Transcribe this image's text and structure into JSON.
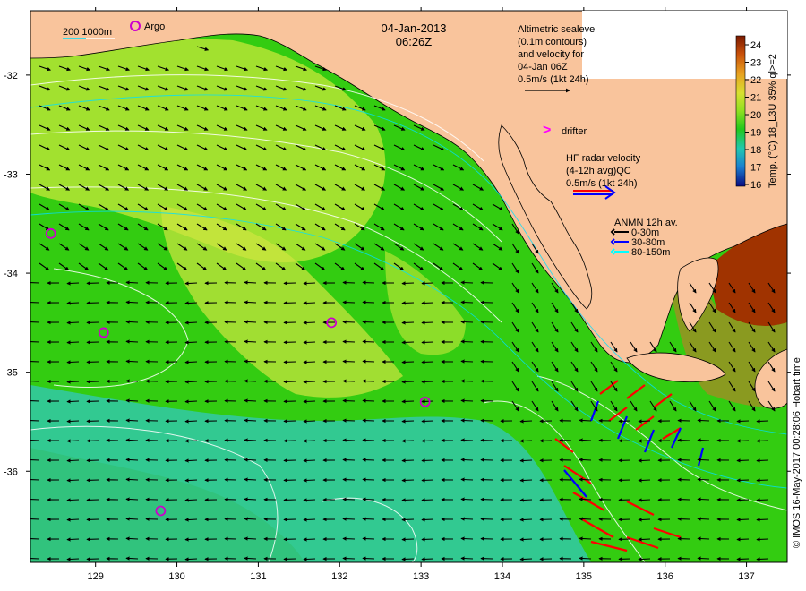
{
  "map": {
    "date": "04-Jan-2013",
    "time": "06:26Z",
    "lon_ticks": [
      "129",
      "130",
      "131",
      "132",
      "133",
      "134",
      "135",
      "136",
      "137"
    ],
    "lat_ticks": [
      "-32",
      "-33",
      "-34",
      "-35",
      "-36"
    ],
    "lon_range": [
      128.2,
      137.5
    ],
    "lat_range": [
      -31.35,
      -36.92
    ]
  },
  "legend": {
    "isobaths": "200  1000m",
    "argo": "Argo",
    "altimetry_lines": [
      "Altimetric sealevel",
      "(0.1m contours)",
      "and velocity for",
      "04-Jan 06Z",
      "0.5m/s (1kt 24h)"
    ],
    "drifter_symbol": ">",
    "drifter": "drifter",
    "hf_radar_lines": [
      "HF radar velocity",
      "(4-12h avg)QC",
      "0.5m/s (1kt 24h)"
    ],
    "anmn_title": "ANMN 12h av.",
    "anmn_items": [
      {
        "label": "0-30m",
        "color": "#000000"
      },
      {
        "label": "30-80m",
        "color": "#0000ff"
      },
      {
        "label": "80-150m",
        "color": "#00ffff"
      }
    ]
  },
  "colorbar": {
    "ticks": [
      "24",
      "23",
      "22",
      "21",
      "20",
      "19",
      "18",
      "17",
      "16"
    ],
    "label": "Temp. (°C) 18_L3U 35% ql>=2"
  },
  "credit": "© IMOS 16-May-2017 00:28:06 Hobart time",
  "argo_floats": [
    {
      "lon": 128.45,
      "lat": -33.6
    },
    {
      "lon": 129.1,
      "lat": -34.6
    },
    {
      "lon": 131.9,
      "lat": -34.5
    },
    {
      "lon": 133.05,
      "lat": -35.3
    },
    {
      "lon": 129.8,
      "lat": -36.4
    }
  ],
  "colors": {
    "land": "#f9c49c",
    "ocean_green": "#33cc11",
    "ocean_yellow": "#c8e83a",
    "ocean_cyan": "#33ccbb",
    "warm_gulf": "#a03300",
    "argo": "#cc00cc",
    "hf_red": "#ff0000",
    "hf_blue": "#0000ff"
  }
}
